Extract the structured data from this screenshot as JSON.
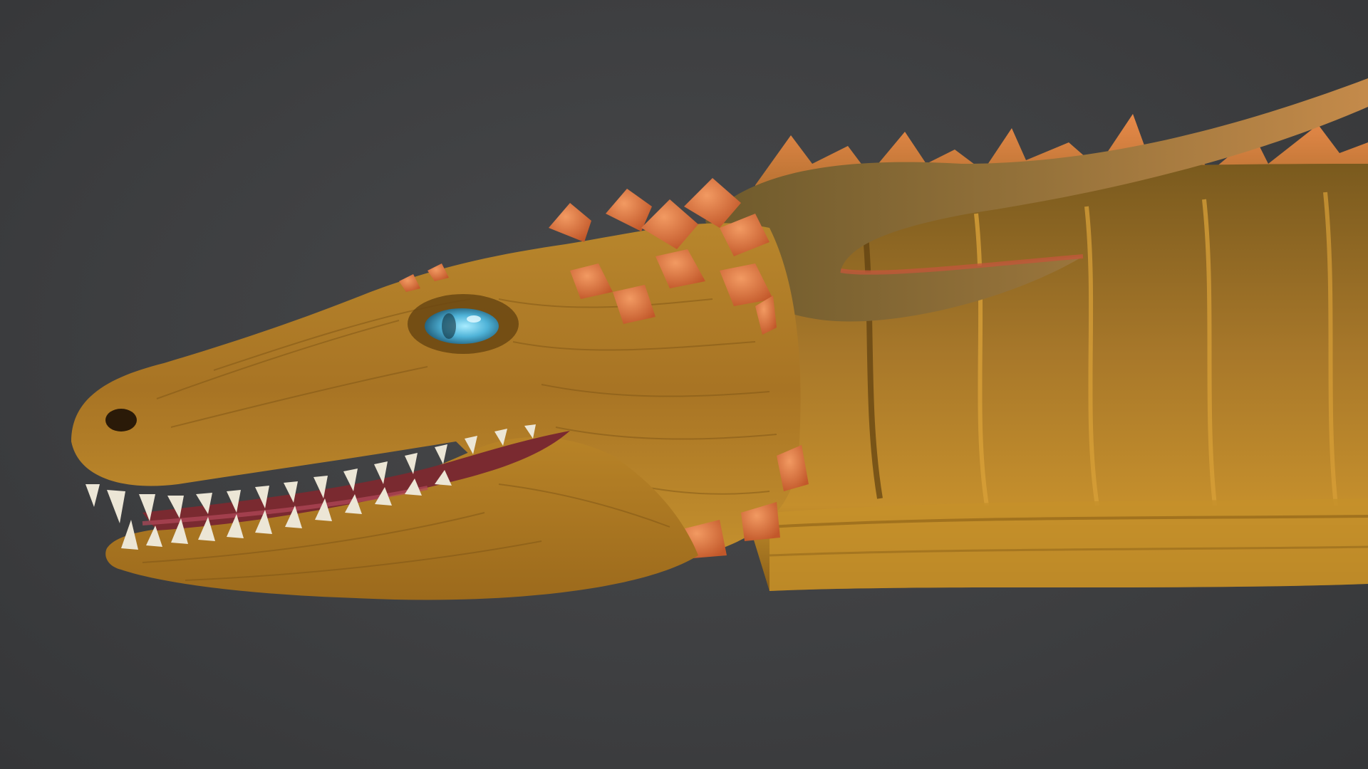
{
  "scene": {
    "subject_icon": "dragon-head-render",
    "colors": {
      "background": "#3e3f41",
      "skin_base": "#b07a22",
      "skin_dark": "#6e4a14",
      "skin_light": "#d6a443",
      "scale_accent": "#e07a3a",
      "horn": "#8a6a30",
      "eye": "#4fb3d8",
      "mouth": "#7a2a30",
      "teeth": "#ece6d6"
    }
  }
}
